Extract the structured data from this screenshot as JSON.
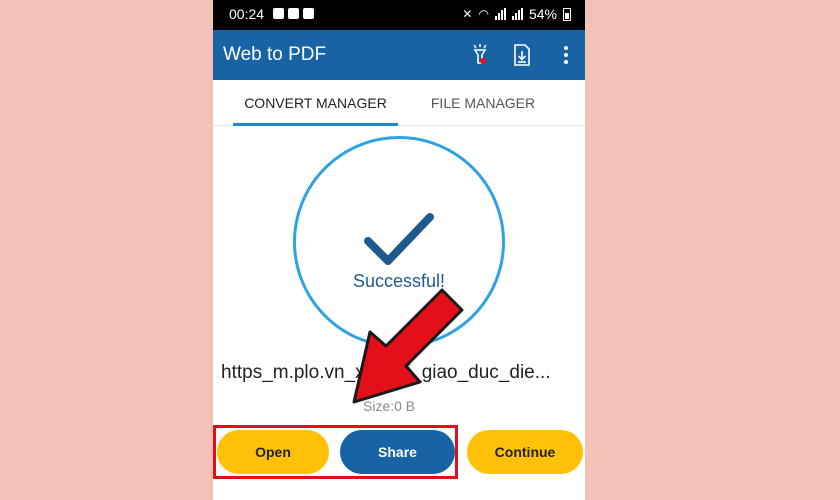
{
  "status_bar": {
    "time": "00:24",
    "battery": "54%"
  },
  "app_bar": {
    "title": "Web to PDF",
    "icons": [
      "flashlight-icon",
      "download-file-icon",
      "more-vertical-icon"
    ]
  },
  "tabs": [
    {
      "label": "CONVERT MANAGER",
      "active": true
    },
    {
      "label": "FILE MANAGER",
      "active": false
    }
  ],
  "result": {
    "status": "Successful!",
    "file_name": "https_m.plo.vn_xa_hoi_giao_duc_die...",
    "file_size": "Size:0 B"
  },
  "buttons": {
    "open": "Open",
    "share": "Share",
    "continue": "Continue"
  },
  "colors": {
    "primary": "#1763a3",
    "accent": "#ffc107",
    "circle": "#2ea2e3",
    "highlight": "#e3101a"
  }
}
